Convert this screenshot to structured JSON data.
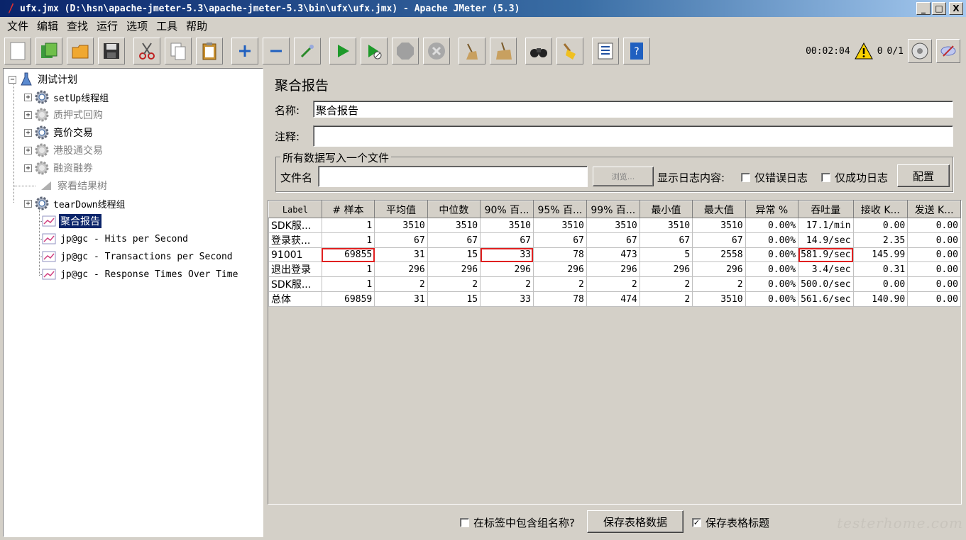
{
  "window": {
    "title": "ufx.jmx (D:\\hsn\\apache-jmeter-5.3\\apache-jmeter-5.3\\bin\\ufx\\ufx.jmx) - Apache JMeter (5.3)",
    "minimize": "_",
    "maximize": "□",
    "close": "X"
  },
  "menu": [
    "文件",
    "编辑",
    "查找",
    "运行",
    "选项",
    "工具",
    "帮助"
  ],
  "status": {
    "elapsed": "00:02:04",
    "warnings": "0",
    "threads": "0/1"
  },
  "tree": {
    "root": "测试计划",
    "items": [
      {
        "label": "setUp线程组",
        "state": "enabled"
      },
      {
        "label": "质押式回购",
        "state": "disabled"
      },
      {
        "label": "竟价交易",
        "state": "enabled"
      },
      {
        "label": "港股通交易",
        "state": "disabled"
      },
      {
        "label": "融资融券",
        "state": "disabled"
      },
      {
        "label": "察看结果树",
        "state": "disabled"
      },
      {
        "label": "tearDown线程组",
        "state": "enabled"
      }
    ],
    "children": [
      {
        "label": "聚合报告",
        "selected": true
      },
      {
        "label": "jp@gc - Hits per Second"
      },
      {
        "label": "jp@gc - Transactions per Second"
      },
      {
        "label": "jp@gc - Response Times Over Time"
      }
    ]
  },
  "report": {
    "title": "聚合报告",
    "name_label": "名称:",
    "name_value": "聚合报告",
    "comment_label": "注释:",
    "comment_value": "",
    "file_group_title": "所有数据写入一个文件",
    "filename_label": "文件名",
    "filename_value": "",
    "browse_button": "浏览...",
    "log_display_label": "显示日志内容:",
    "errors_only": "仅错误日志",
    "success_only": "仅成功日志",
    "configure_button": "配置"
  },
  "table": {
    "headers": [
      "Label",
      "# 样本",
      "平均值",
      "中位数",
      "90% 百...",
      "95% 百...",
      "99% 百...",
      "最小值",
      "最大值",
      "异常 %",
      "吞吐量",
      "接收 K...",
      "发送 K..."
    ],
    "rows": [
      [
        "SDK服...",
        "1",
        "3510",
        "3510",
        "3510",
        "3510",
        "3510",
        "3510",
        "3510",
        "0.00%",
        "17.1/min",
        "0.00",
        "0.00"
      ],
      [
        "登录获...",
        "1",
        "67",
        "67",
        "67",
        "67",
        "67",
        "67",
        "67",
        "0.00%",
        "14.9/sec",
        "2.35",
        "0.00"
      ],
      [
        "91001",
        "69855",
        "31",
        "15",
        "33",
        "78",
        "473",
        "5",
        "2558",
        "0.00%",
        "581.9/sec",
        "145.99",
        "0.00"
      ],
      [
        "退出登录",
        "1",
        "296",
        "296",
        "296",
        "296",
        "296",
        "296",
        "296",
        "0.00%",
        "3.4/sec",
        "0.31",
        "0.00"
      ],
      [
        "SDK服...",
        "1",
        "2",
        "2",
        "2",
        "2",
        "2",
        "2",
        "2",
        "0.00%",
        "500.0/sec",
        "0.00",
        "0.00"
      ],
      [
        "总体",
        "69859",
        "31",
        "15",
        "33",
        "78",
        "474",
        "2",
        "3510",
        "0.00%",
        "561.6/sec",
        "140.90",
        "0.00"
      ]
    ]
  },
  "bottom": {
    "include_group_name": "在标签中包含组名称?",
    "save_table_data": "保存表格数据",
    "save_table_header": "保存表格标题"
  },
  "watermark": "testerhome.com",
  "colors": {
    "highlight": "#e02020",
    "selection": "#0a246a",
    "titlebar": "#0a246a"
  }
}
